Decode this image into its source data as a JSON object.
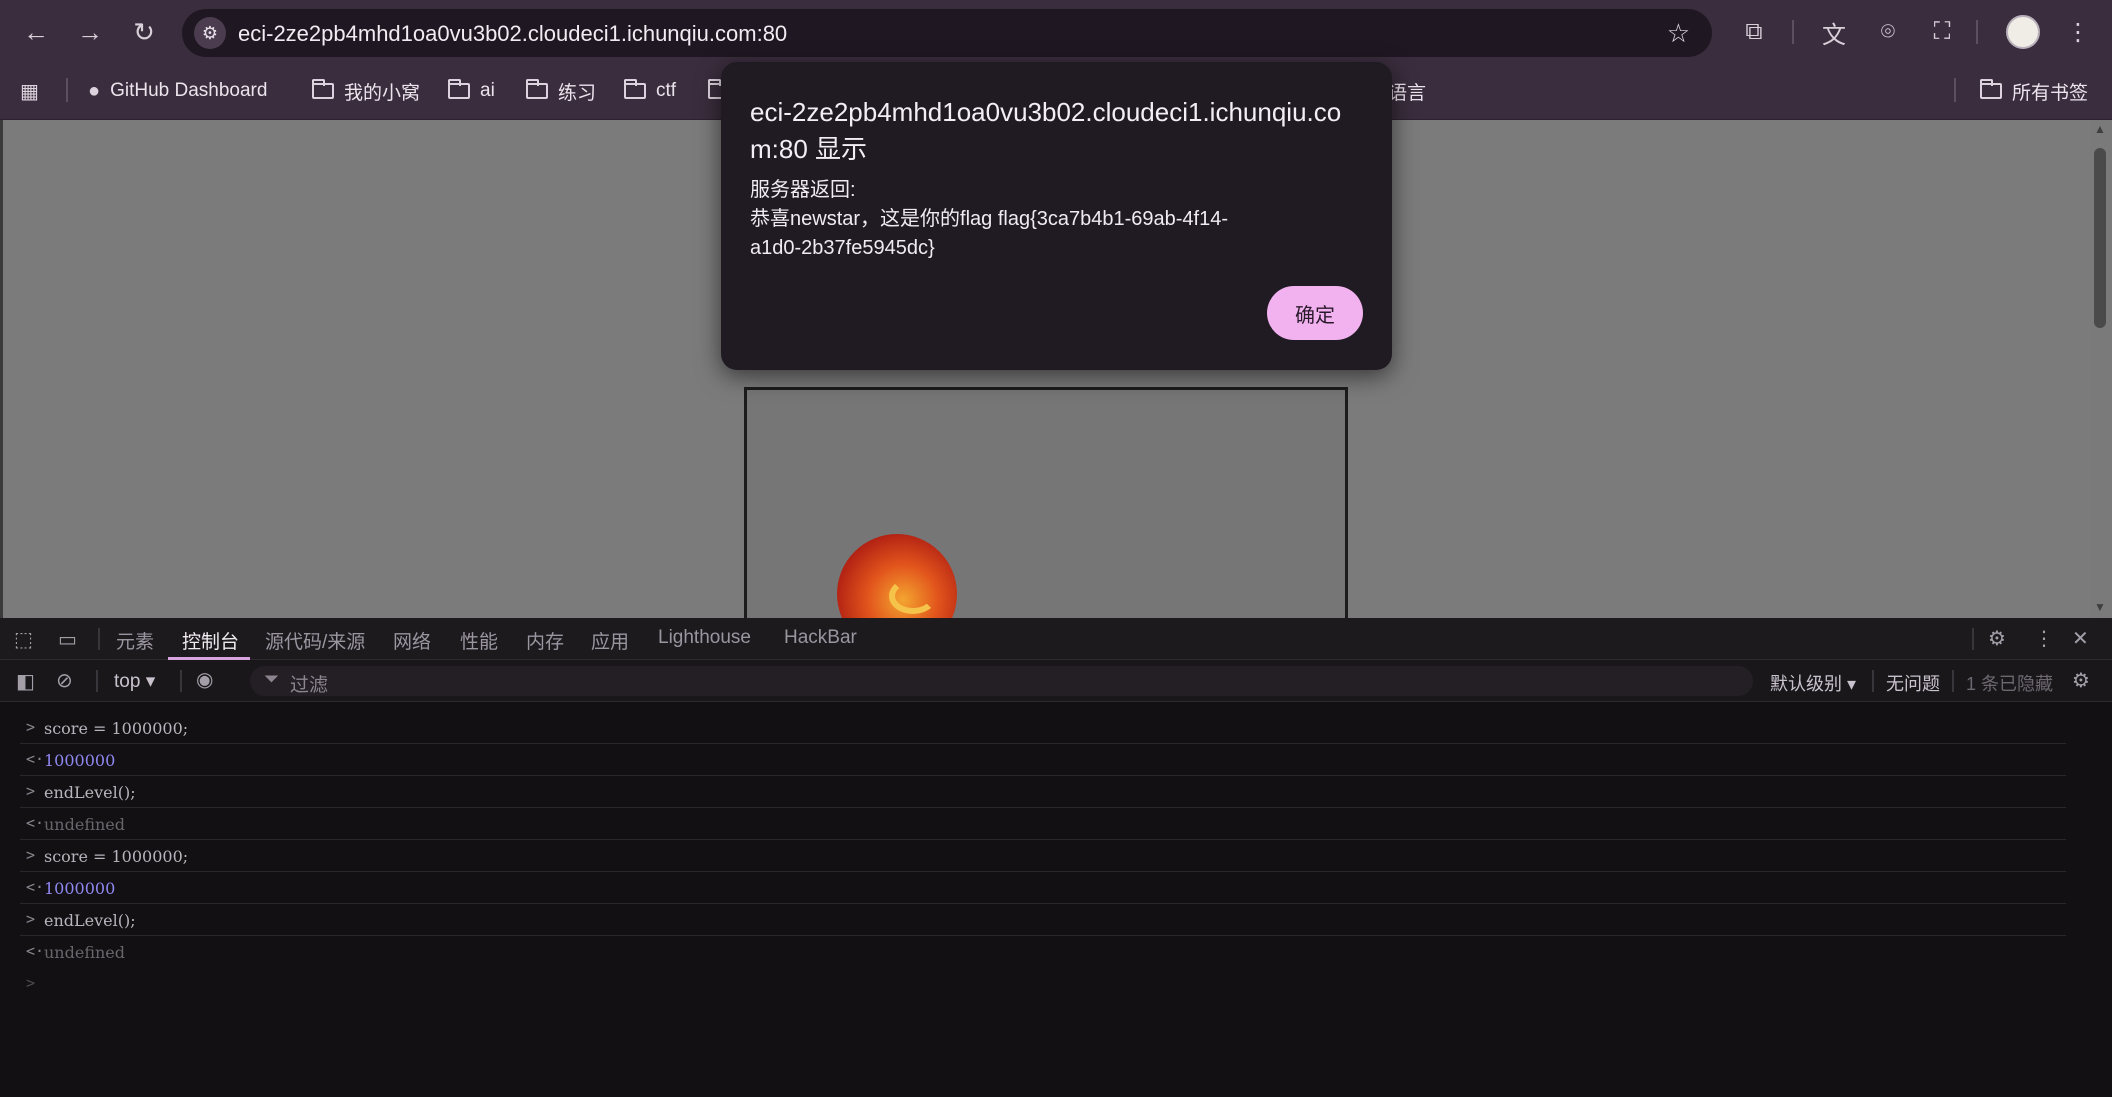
{
  "browser": {
    "url": "eci-2ze2pb4mhd1oa0vu3b02.cloudeci1.ichunqiu.com:80",
    "nav": {
      "back": "←",
      "forward": "→",
      "reload": "↻"
    },
    "site_icon": "⚙",
    "star": "☆",
    "toolbar_icons": {
      "extensions": "⧉",
      "translate": "文",
      "lens": "⌾",
      "incognito": "⛶",
      "menu": "⋮"
    }
  },
  "bookmarks": {
    "apps_icon": "▦",
    "github_icon": "●",
    "items": [
      {
        "label": "GitHub Dashboard"
      },
      {
        "label": "我的小窝"
      },
      {
        "label": "ai"
      },
      {
        "label": "练习"
      },
      {
        "label": "ctf"
      },
      {
        "label": "语言"
      }
    ],
    "all_bookmarks": "所有书签"
  },
  "dialog": {
    "title": "eci-2ze2pb4mhd1oa0vu3b02.cloudeci1.ichunqiu.com:80 显示",
    "line1": "服务器返回:",
    "line2": "恭喜newstar，这是你的flag flag{3ca7b4b1-69ab-4f14-",
    "line3": "a1d0-2b37fe5945dc}",
    "ok": "确定"
  },
  "devtools": {
    "tabs": [
      {
        "label": "元素"
      },
      {
        "label": "控制台"
      },
      {
        "label": "源代码/来源"
      },
      {
        "label": "网络"
      },
      {
        "label": "性能"
      },
      {
        "label": "内存"
      },
      {
        "label": "应用"
      },
      {
        "label": "Lighthouse"
      },
      {
        "label": "HackBar"
      }
    ],
    "context": "top ▾",
    "filter_placeholder": "过滤",
    "level": "默认级别 ▾",
    "issues": "无问题",
    "hidden": "1 条已隐藏",
    "console": [
      {
        "dir": ">",
        "text": "score = 1000000;"
      },
      {
        "dir": "<·",
        "text": "1000000"
      },
      {
        "dir": ">",
        "text": "endLevel();"
      },
      {
        "dir": "<·",
        "text": "undefined"
      },
      {
        "dir": ">",
        "text": "score = 1000000;"
      },
      {
        "dir": "<·",
        "text": "1000000"
      },
      {
        "dir": ">",
        "text": "endLevel();"
      },
      {
        "dir": "<·",
        "text": "undefined"
      }
    ],
    "prompt": ">"
  }
}
